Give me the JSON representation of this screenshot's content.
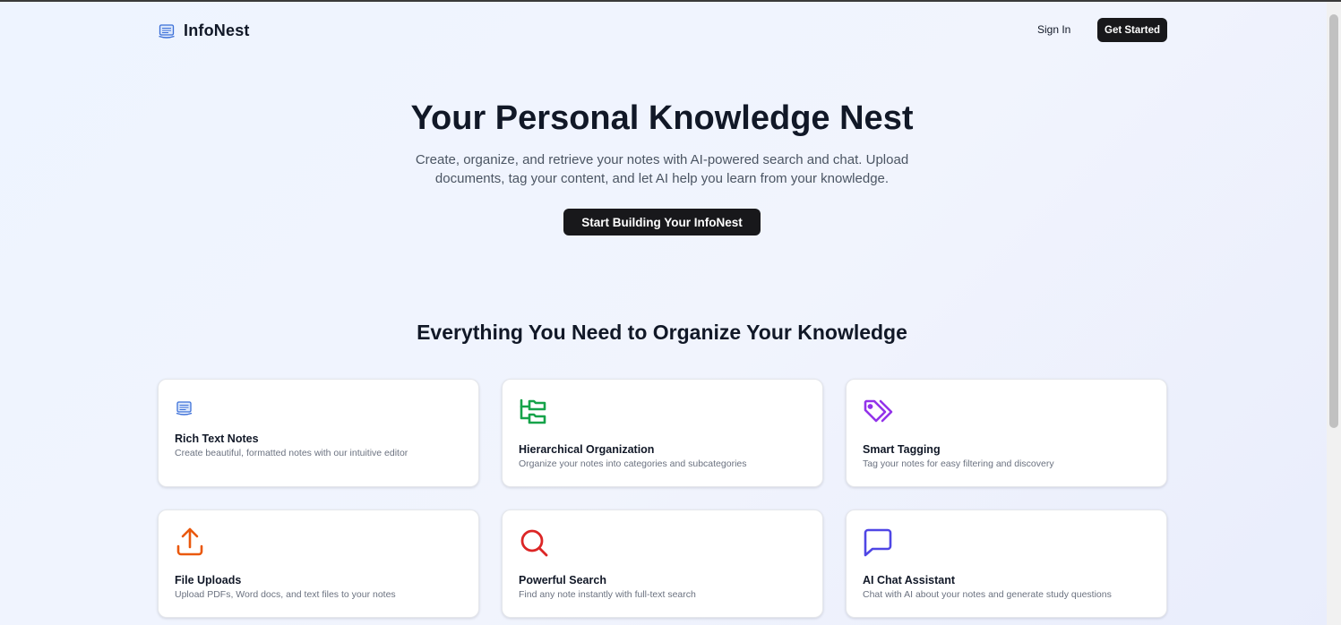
{
  "header": {
    "brand": "InfoNest",
    "sign_in": "Sign In",
    "get_started": "Get Started"
  },
  "hero": {
    "title": "Your Personal Knowledge Nest",
    "subtitle_line1": "Create, organize, and retrieve your notes with AI-powered search and chat. Upload",
    "subtitle_line2": "documents, tag your content, and let AI help you learn from your knowledge.",
    "cta": "Start Building Your InfoNest"
  },
  "features": {
    "heading": "Everything You Need to Organize Your Knowledge",
    "cards": [
      {
        "title": "Rich Text Notes",
        "description": "Create beautiful, formatted notes with our intuitive editor",
        "icon": "notebook-icon",
        "color": "#3b82f6"
      },
      {
        "title": "Hierarchical Organization",
        "description": "Organize your notes into categories and subcategories",
        "icon": "folder-tree-icon",
        "color": "#16a34a"
      },
      {
        "title": "Smart Tagging",
        "description": "Tag your notes for easy filtering and discovery",
        "icon": "tags-icon",
        "color": "#9333ea"
      },
      {
        "title": "File Uploads",
        "description": "Upload PDFs, Word docs, and text files to your notes",
        "icon": "upload-icon",
        "color": "#ea580c"
      },
      {
        "title": "Powerful Search",
        "description": "Find any note instantly with full-text search",
        "icon": "search-icon",
        "color": "#dc2626"
      },
      {
        "title": "AI Chat Assistant",
        "description": "Chat with AI about your notes and generate study questions",
        "icon": "message-square-icon",
        "color": "#4f46e5"
      }
    ]
  }
}
